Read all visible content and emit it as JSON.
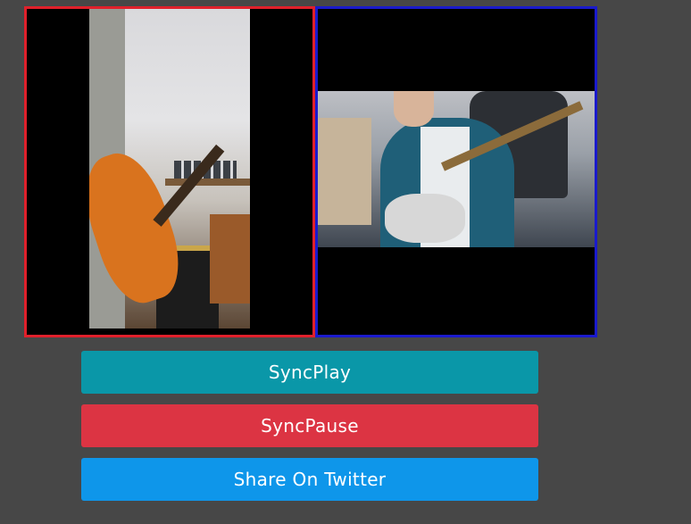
{
  "buttons": {
    "sync_play": "SyncPlay",
    "sync_pause": "SyncPause",
    "share_twitter": "Share On Twitter"
  },
  "colors": {
    "background": "#474747",
    "left_video_border": "#e0202b",
    "right_video_border": "#1a1acc",
    "sync_play": "#0a97a8",
    "sync_pause": "#dc3443",
    "share_twitter": "#0e96ea"
  }
}
